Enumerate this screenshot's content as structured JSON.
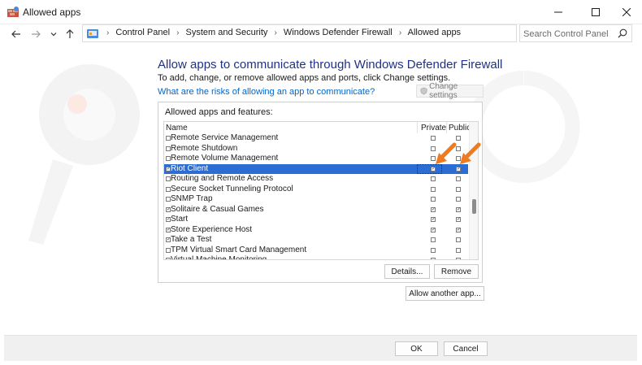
{
  "window": {
    "title": "Allowed apps",
    "minimize_icon": "minimize-icon",
    "maximize_icon": "maximize-icon",
    "close_icon": "close-icon"
  },
  "address_bar": {
    "breadcrumbs": [
      "Control Panel",
      "System and Security",
      "Windows Defender Firewall",
      "Allowed apps"
    ],
    "search_placeholder": "Search Control Panel"
  },
  "main": {
    "heading": "Allow apps to communicate through Windows Defender Firewall",
    "subtext": "To add, change, or remove allowed apps and ports, click Change settings.",
    "risk_link": "What are the risks of allowing an app to communicate?",
    "change_settings_label": "Change settings",
    "group_label": "Allowed apps and features:",
    "columns": {
      "name": "Name",
      "private": "Private",
      "public": "Public"
    },
    "apps": [
      {
        "name": "Remote Service Management",
        "enabled": false,
        "private": false,
        "public": false
      },
      {
        "name": "Remote Shutdown",
        "enabled": false,
        "private": false,
        "public": false
      },
      {
        "name": "Remote Volume Management",
        "enabled": false,
        "private": false,
        "public": false
      },
      {
        "name": "Riot Client",
        "enabled": true,
        "private": true,
        "public": true,
        "selected": true
      },
      {
        "name": "Routing and Remote Access",
        "enabled": false,
        "private": false,
        "public": false
      },
      {
        "name": "Secure Socket Tunneling Protocol",
        "enabled": false,
        "private": false,
        "public": false
      },
      {
        "name": "SNMP Trap",
        "enabled": false,
        "private": false,
        "public": false
      },
      {
        "name": "Solitaire & Casual Games",
        "enabled": true,
        "private": true,
        "public": true
      },
      {
        "name": "Start",
        "enabled": true,
        "private": true,
        "public": true
      },
      {
        "name": "Store Experience Host",
        "enabled": true,
        "private": true,
        "public": true
      },
      {
        "name": "Take a Test",
        "enabled": true,
        "private": false,
        "public": false
      },
      {
        "name": "TPM Virtual Smart Card Management",
        "enabled": false,
        "private": false,
        "public": false
      },
      {
        "name": "Virtual Machine Monitoring",
        "enabled": false,
        "private": false,
        "public": false
      }
    ],
    "details_label": "Details...",
    "remove_label": "Remove",
    "allow_another_label": "Allow another app..."
  },
  "footer": {
    "ok_label": "OK",
    "cancel_label": "Cancel"
  },
  "colors": {
    "heading": "#1e3287",
    "link": "#0066cc",
    "selection": "#2b6dd2",
    "arrow": "#f07a1e"
  }
}
